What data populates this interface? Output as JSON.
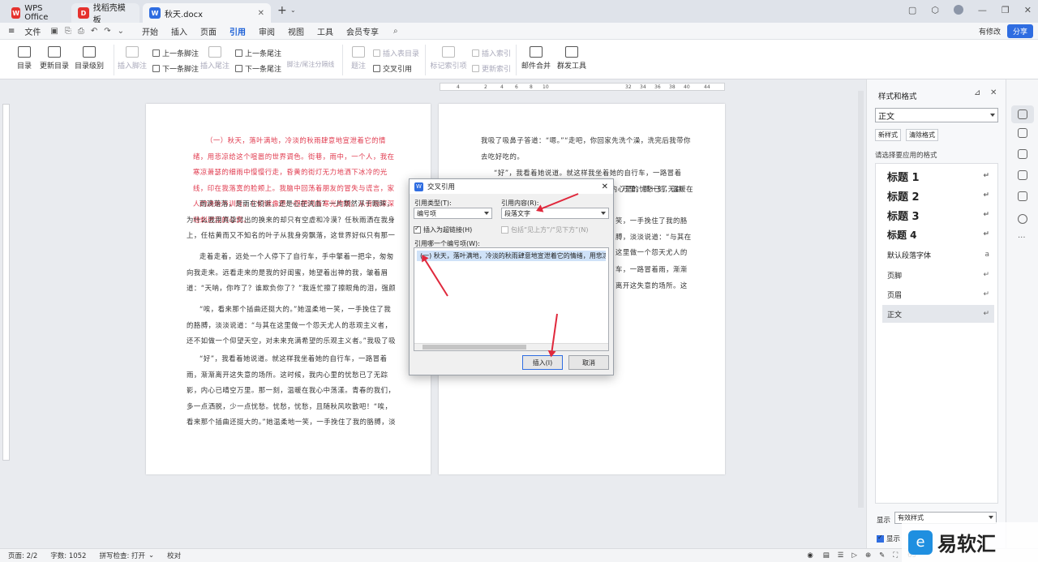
{
  "tabs": [
    {
      "label": "WPS Office",
      "logo": "W",
      "color": "#e5322e"
    },
    {
      "label": "找稻壳模板",
      "logo": "D",
      "color": "#e5322e"
    },
    {
      "label": "秋天.docx",
      "logo": "W",
      "color": "#2f6de1"
    }
  ],
  "menu": {
    "file": "文件",
    "items": [
      "开始",
      "插入",
      "页面",
      "引用",
      "审阅",
      "视图",
      "工具",
      "会员专享"
    ],
    "active": "引用",
    "modified": "有修改",
    "share": "分享"
  },
  "ribbon": {
    "toc": "目录",
    "update_toc": "更新目录",
    "toc_level": "目录级别",
    "insert_footnote": "插入脚注",
    "prev_footnote": "上一条脚注",
    "next_footnote": "下一条脚注",
    "insert_endnote": "插入尾注",
    "prev_endnote": "上一条尾注",
    "next_endnote": "下一条尾注",
    "footnote_sep": "脚注/尾注分隔线",
    "caption": "题注",
    "insert_figure_toc": "插入表目录",
    "cross_ref": "交叉引用",
    "mark_index": "标记索引项",
    "insert_index": "插入索引",
    "update_index": "更新索引",
    "mail_merge": "邮件合并",
    "group_tools": "群发工具"
  },
  "ruler_ticks": [
    "4",
    "2",
    "4",
    "6",
    "8",
    "10",
    "32",
    "34",
    "36",
    "38",
    "40",
    "44"
  ],
  "doc": {
    "p1": "（一）秋天，落叶满地，冷淡的秋雨肆意地宣泄着它的情绪，用悲凉给这个喧嚣的世界调色。街巷，雨中，一个人，我在寒凉萧瑟的细雨中慢慢行走，昏黄的街灯无力地洒下冰冷的光线，印在我落寞的脸颊上。我脑中回荡着朋友的冒失与谎言，家人的决绝与训斥，它们就像是一把把闪着寒光的刺，从背后深深地刺进我的心窝。",
    "p2": "雨滴落落，是雨在倾诉，还是心在流血？一片颓然浮于眼眸，为什么我用真挚付出的换来的却只有空虚和冷漠？任秋雨洒在我身上，任枯黄而又不知名的叶子从我身旁飘落，这世界好似只有那一种颜色——冰冷的灰色。望向灰濛濛的天空，眼前逐渐泪眼朦胧。",
    "p3": "走着走着，远处一个人停下了自行车，手中擎着一把伞，匆匆向我走来。远看走来的是我的好闺蜜，她望着出神的我，皱着眉道：“天呐，你咋了？谁欺负你了？”我连忙擦了擦眼角的泪，强颜欢笑道：“只是碰到了一些不愉快的小插曲，没事的。”",
    "p4": "“唉，看来那个插曲还挺大的。”她温柔地一笑，一手挽住了我的胳膊，淡淡说道：“与其在这里做一个怨天尤人的悲观主义者，还不如做一个仰望天空，对未来充满希望的乐观主义者。”我吸了吸鼻子答道：“嗯。”“走吧，你回家先洗个澡，洗完后我带你去吃好吃的。”",
    "p5": "“好”，我看着她说道。就这样我坐着她的自行车，一路冒着雨，渐渐离开这失意的场所。这时候，我内心里的忧愁已了无踪影，内心已晴空万里。那一刻，温暖在我心中荡漾。青春的我们，多一点洒脱，少一点忧愁。忧愁，忧愁，且随秋风吹散吧！“唉，看来那个插曲还挺大的。”她温柔地一笑，一手挽住了我的胳膊，淡淡说道：“与其在这里做一个怨天尤人的悲观主义者，还不如做一个仰望天空，对未来充满希望的乐观主义者。”",
    "r1": "我吸了吸鼻子答道：“嗯。”“走吧，你回家先洗个澡，洗完后我带你去吃好吃的。",
    "r2a": "“好”，我看着她说道。就这样我坐着她的自行车，一路冒着雨，渐渐离开这失意的场所。这时候，我内心里的忧愁已了无踪影，内心已晴空",
    "r2b": "万里。那一刻，温暖在我心中荡漾。青春的我们，多一点洒脱，少一点忧",
    "r3": "笑，一手挽住了我的胳膊，淡淡说道：“与其在这里做一个怨天尤人的悲观主义者，还不如做一个仰望天空，对未来充满希望的乐观主义者。”我吸了吸鼻子答道：“嗯。”“走吧，你回家先洗个澡，洗完后我带你去吃好吃的。",
    "r4": "车，一路冒着雨，渐渐离开这失意的场所。这时候，我内心里的忧愁已了无踪影，内心已晴空万里。那一刻，温暖在我心中荡漾。青春的我们，多一点洒脱，少一点忧"
  },
  "dialog": {
    "title": "交叉引用",
    "ref_type_label": "引用类型(T):",
    "ref_type": "编号项",
    "ref_content_label": "引用内容(R):",
    "ref_content": "段落文字",
    "hyperlink": "插入为超链接(H)",
    "above_below": "包括“见上方”/“见下方”(N)",
    "which_label": "引用哪一个编号项(W):",
    "item": "(一)  秋天，落叶满地，冷淡的秋雨肆意地宣泄着它的情绪，用悲凉",
    "insert": "插入(I)",
    "cancel": "取消"
  },
  "panel": {
    "title": "样式和格式",
    "current": "正文",
    "new_style": "新样式",
    "clear_format": "清除格式",
    "choose": "请选择要应用的格式",
    "styles": [
      "标题 1",
      "标题 2",
      "标题 3",
      "标题 4",
      "默认段落字体",
      "页脚",
      "页眉",
      "正文"
    ],
    "show_label": "显示",
    "show_value": "有效样式",
    "show_preview": "显示"
  },
  "status": {
    "page": "页面: 2/2",
    "words": "字数: 1052",
    "spell": "拼写检查: 打开",
    "proof": "校对",
    "zoom": "65"
  },
  "watermark": "易软汇"
}
